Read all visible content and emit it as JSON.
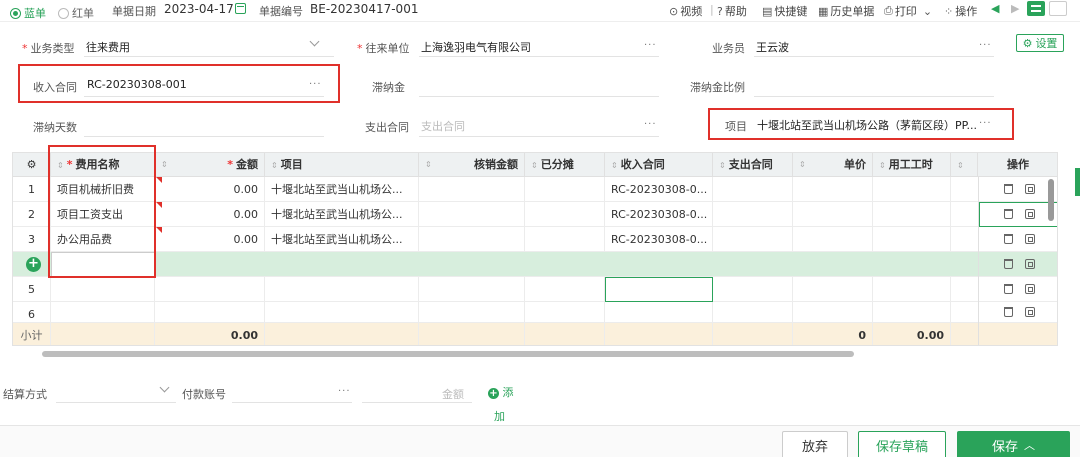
{
  "topbar": {
    "blue_label": "蓝单",
    "red_label": "红单",
    "date_label": "单据日期",
    "date_value": "2023-04-17",
    "number_label": "单据编号",
    "number_value": "BE-20230417-001",
    "tools": [
      "视频",
      "帮助",
      "快捷键",
      "历史单据",
      "打印",
      "操作"
    ],
    "icons": [
      "play-icon",
      "help-icon",
      "keyboard-icon",
      "history-icon",
      "print-icon",
      "grid-icon"
    ]
  },
  "form": {
    "business_type_label": "业务类型",
    "business_type_value": "往来费用",
    "partner_label": "往来单位",
    "partner_value": "上海逸羽电气有限公司",
    "salesman_label": "业务员",
    "salesman_value": "王云波",
    "settings_label": "设置",
    "income_contract_label": "收入合同",
    "income_contract_value": "RC-20230308-001",
    "late_fee_label": "滞纳金",
    "late_fee_ratio_label": "滞纳金比例",
    "late_days_label": "滞纳天数",
    "expense_contract_label": "支出合同",
    "expense_contract_placeholder": "支出合同",
    "project_label": "项目",
    "project_value": "十堰北站至武当山机场公路（茅箭区段）PP..."
  },
  "table": {
    "headers": [
      "费用名称",
      "金额",
      "项目",
      "核销金额",
      "已分摊",
      "收入合同",
      "支出合同",
      "单价",
      "用工工时",
      "操作"
    ],
    "rows": [
      {
        "no": "1",
        "name": "项目机械折旧费",
        "amount": "0.00",
        "project": "十堰北站至武当山机场公...",
        "contract": "RC-20230308-0..."
      },
      {
        "no": "2",
        "name": "项目工资支出",
        "amount": "0.00",
        "project": "十堰北站至武当山机场公...",
        "contract": "RC-20230308-0..."
      },
      {
        "no": "3",
        "name": "办公用品费",
        "amount": "0.00",
        "project": "十堰北站至武当山机场公...",
        "contract": "RC-20230308-0..."
      }
    ],
    "row5": "5",
    "row6": "6",
    "subtotal_label": "小计",
    "subtotal_amount": "0.00",
    "subtotal_price": "0",
    "subtotal_hours": "0.00"
  },
  "footer": {
    "settle_label": "结算方式",
    "account_label": "付款账号",
    "amount_placeholder": "金额",
    "add_label": "添",
    "add_label2": "加"
  },
  "buttons": {
    "discard": "放弃",
    "save_draft": "保存草稿",
    "save": "保存"
  },
  "colors": {
    "accent": "#2aa35a",
    "highlight": "#e0302a",
    "add_row": "#d7eedd",
    "subtotal_row": "#fbf0dc"
  }
}
